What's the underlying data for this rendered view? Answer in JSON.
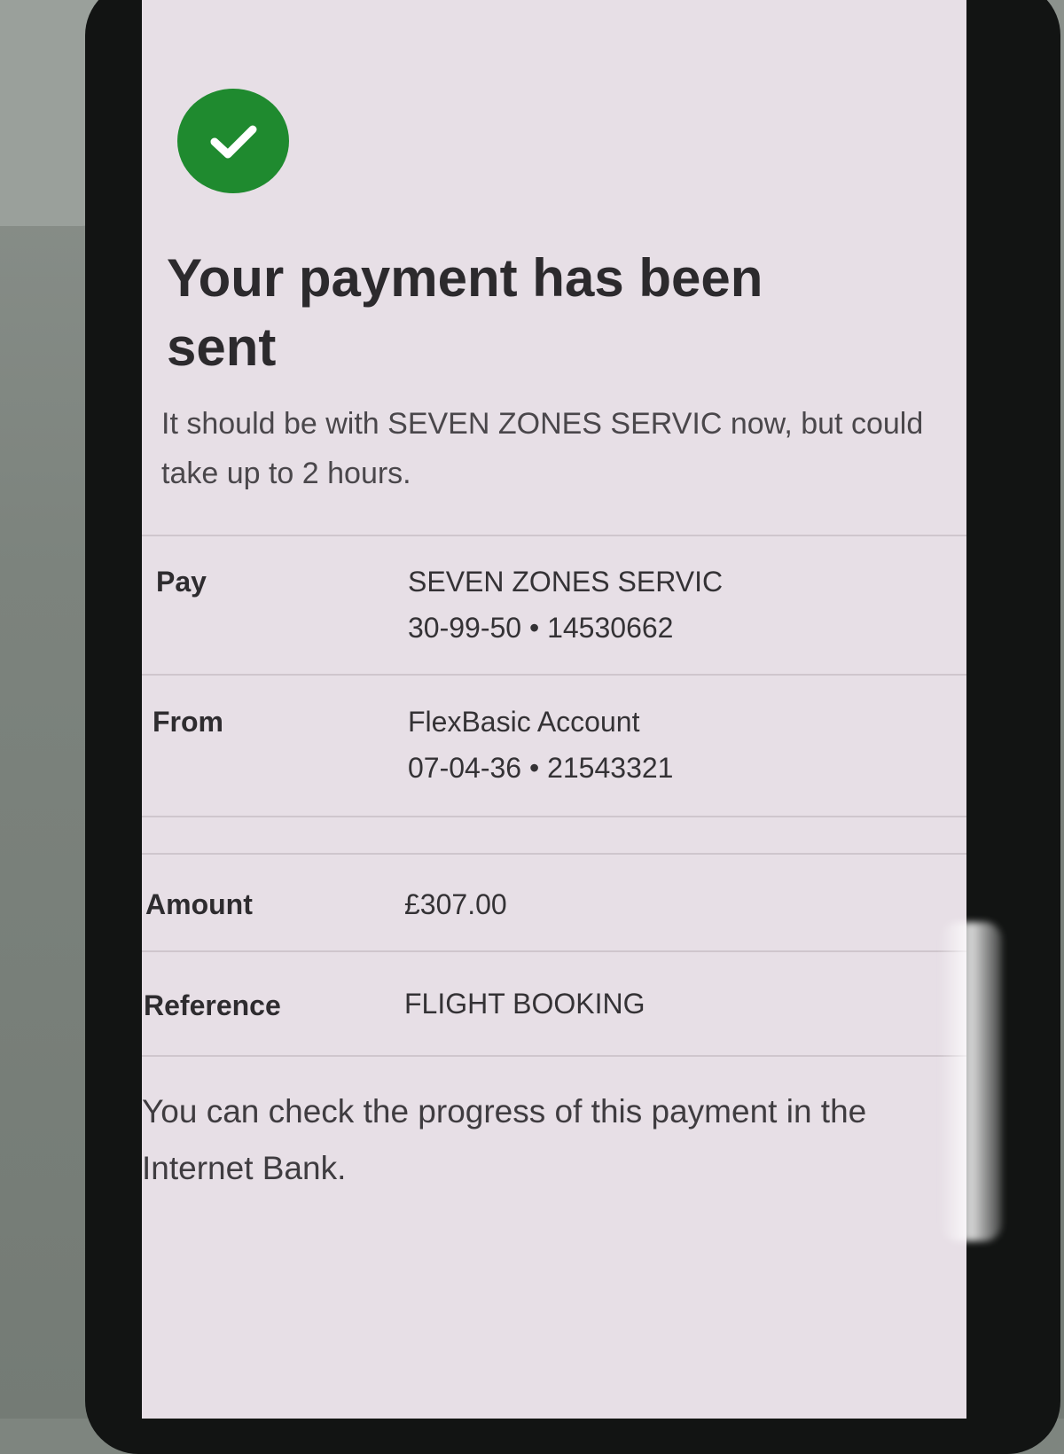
{
  "confirmation": {
    "title": "Your payment has been sent",
    "message": "It should be with SEVEN ZONES SERVIC now, but could take up to 2 hours."
  },
  "details": {
    "pay": {
      "label": "Pay",
      "name": "SEVEN ZONES SERVIC",
      "account": "30-99-50 • 14530662"
    },
    "from": {
      "label": "From",
      "name": "FlexBasic Account",
      "account": "07-04-36 • 21543321"
    },
    "amount": {
      "label": "Amount",
      "value": "£307.00"
    },
    "reference": {
      "label": "Reference",
      "value": "FLIGHT BOOKING"
    }
  },
  "footer": {
    "text": "You can check the progress of this payment in the Internet Bank."
  },
  "icons": {
    "status": "check-icon"
  },
  "colors": {
    "success": "#1f8a2f",
    "screen_background": "#e7dfe6"
  }
}
